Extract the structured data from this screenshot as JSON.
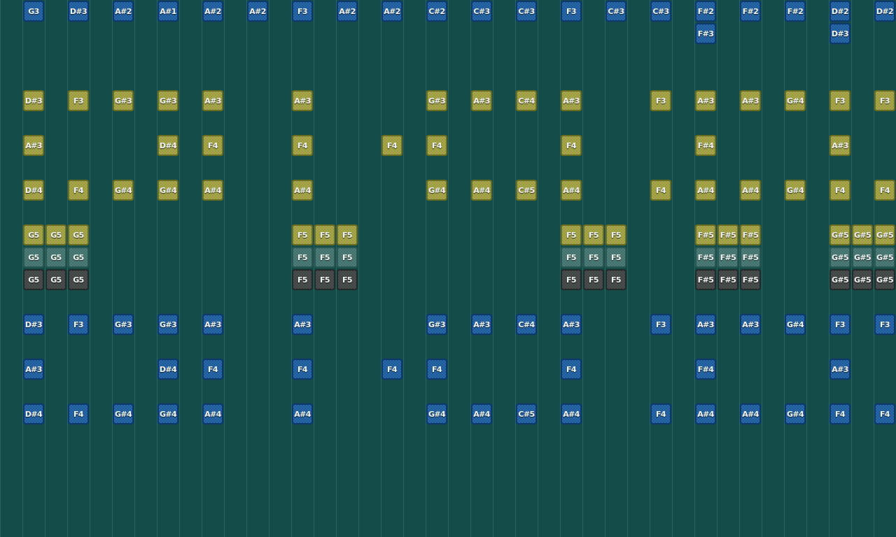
{
  "colors": {
    "background": "#134c49",
    "blue": "#1a5a9c",
    "yellow": "#9c9b3c",
    "teal": "#3f706c",
    "dark": "#3d4243"
  },
  "rows": [
    {
      "style": "blue",
      "cells": {
        "1": "G3",
        "3": "D#3",
        "5": "A#2",
        "7": "A#1",
        "9": "A#2",
        "11": "A#2",
        "13": "F3",
        "15": "A#2",
        "17": "A#2",
        "19": "C#2",
        "21": "C#3",
        "23": "C#3",
        "25": "F3",
        "27": "C#3",
        "29": "C#3",
        "31": "F#2",
        "33": "F#2",
        "35": "F#2",
        "37": "D#2",
        "39": "D#2"
      }
    },
    {
      "style": "blue",
      "cells": {
        "31": "F#3",
        "37": "D#3"
      }
    },
    {
      "style": "blue",
      "cells": {}
    },
    {
      "style": "blue",
      "cells": {}
    },
    {
      "style": "yellow",
      "cells": {
        "1": "D#3",
        "3": "F3",
        "5": "G#3",
        "7": "G#3",
        "9": "A#3",
        "13": "A#3",
        "19": "G#3",
        "21": "A#3",
        "23": "C#4",
        "25": "A#3",
        "29": "F3",
        "31": "A#3",
        "33": "A#3",
        "35": "G#4",
        "37": "F3",
        "39": "F3"
      }
    },
    {
      "style": "blue",
      "cells": {}
    },
    {
      "style": "yellow",
      "cells": {
        "1": "A#3",
        "7": "D#4",
        "9": "F4",
        "13": "F4",
        "17": "F4",
        "19": "F4",
        "25": "F4",
        "31": "F#4",
        "37": "A#3"
      }
    },
    {
      "style": "blue",
      "cells": {}
    },
    {
      "style": "yellow",
      "cells": {
        "1": "D#4",
        "3": "F4",
        "5": "G#4",
        "7": "G#4",
        "9": "A#4",
        "13": "A#4",
        "19": "G#4",
        "21": "A#4",
        "23": "C#5",
        "25": "A#4",
        "29": "F4",
        "31": "A#4",
        "33": "A#4",
        "35": "G#4",
        "37": "F4",
        "39": "F4"
      }
    },
    {
      "style": "blue",
      "cells": {}
    },
    {
      "style": "yellow",
      "cells": {
        "1": "G5",
        "2": "G5",
        "3": "G5",
        "13": "F5",
        "14": "F5",
        "15": "F5",
        "25": "F5",
        "26": "F5",
        "27": "F5",
        "31": "F#5",
        "32": "F#5",
        "33": "F#5",
        "37": "G#5",
        "38": "G#5",
        "39": "G#5"
      }
    },
    {
      "style": "teal",
      "cells": {
        "1": "G5",
        "2": "G5",
        "3": "G5",
        "13": "F5",
        "14": "F5",
        "15": "F5",
        "25": "F5",
        "26": "F5",
        "27": "F5",
        "31": "F#5",
        "32": "F#5",
        "33": "F#5",
        "37": "G#5",
        "38": "G#5",
        "39": "G#5"
      }
    },
    {
      "style": "dark",
      "cells": {
        "1": "G5",
        "2": "G5",
        "3": "G5",
        "13": "F5",
        "14": "F5",
        "15": "F5",
        "25": "F5",
        "26": "F5",
        "27": "F5",
        "31": "F#5",
        "32": "F#5",
        "33": "F#5",
        "37": "G#5",
        "38": "G#5",
        "39": "G#5"
      }
    },
    {
      "style": "blue",
      "cells": {}
    },
    {
      "style": "blue",
      "cells": {
        "1": "D#3",
        "3": "F3",
        "5": "G#3",
        "7": "G#3",
        "9": "A#3",
        "13": "A#3",
        "19": "G#3",
        "21": "A#3",
        "23": "C#4",
        "25": "A#3",
        "29": "F3",
        "31": "A#3",
        "33": "A#3",
        "35": "G#4",
        "37": "F3",
        "39": "F3"
      }
    },
    {
      "style": "blue",
      "cells": {}
    },
    {
      "style": "blue",
      "cells": {
        "1": "A#3",
        "7": "D#4",
        "9": "F4",
        "13": "F4",
        "17": "F4",
        "19": "F4",
        "25": "F4",
        "31": "F#4",
        "37": "A#3"
      }
    },
    {
      "style": "blue",
      "cells": {}
    },
    {
      "style": "blue",
      "cells": {
        "1": "D#4",
        "3": "F4",
        "5": "G#4",
        "7": "G#4",
        "9": "A#4",
        "13": "A#4",
        "19": "G#4",
        "21": "A#4",
        "23": "C#5",
        "25": "A#4",
        "29": "F4",
        "31": "A#4",
        "33": "A#4",
        "35": "G#4",
        "37": "F4",
        "39": "F4"
      }
    }
  ]
}
